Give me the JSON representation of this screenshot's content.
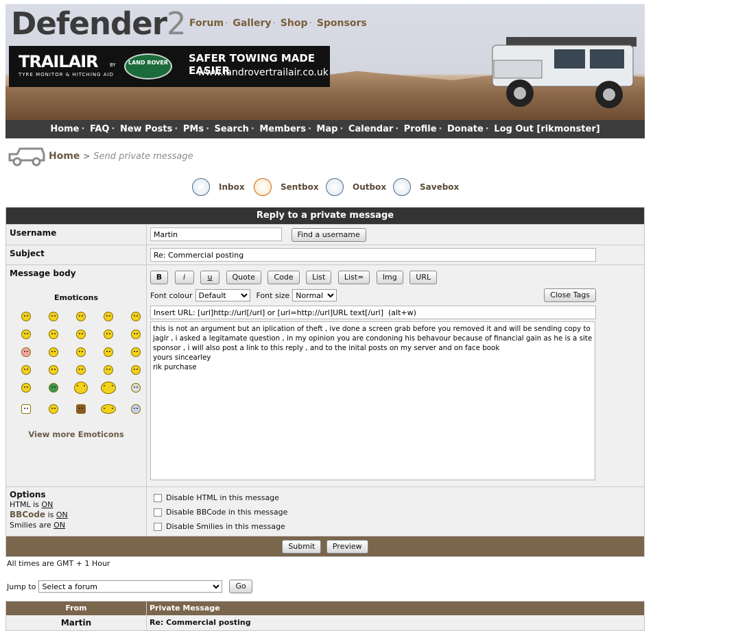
{
  "site": {
    "logo_main": "Defender",
    "logo_num": "2",
    "top_links": [
      "Forum",
      "Gallery",
      "Shop",
      "Sponsors"
    ]
  },
  "banner": {
    "brand": "TRAILAIR",
    "tagline": "TYRE MONITOR & HITCHING AID",
    "by": "BY",
    "partner": "LAND ROVER",
    "slogan": "SAFER TOWING MADE EASIER",
    "url": "www.landrovertrailair.co.uk"
  },
  "nav": [
    "Home",
    "FAQ",
    "New Posts",
    "PMs",
    "Search",
    "Members",
    "Map",
    "Calendar",
    "Profile",
    "Donate",
    "Log Out [rikmonster]"
  ],
  "breadcrumb": {
    "home": "Home",
    "sep": ">",
    "current": "Send private message"
  },
  "folders": [
    "Inbox",
    "Sentbox",
    "Outbox",
    "Savebox"
  ],
  "form": {
    "caption": "Reply to a private message",
    "username_label": "Username",
    "username_value": "Martin",
    "find_button": "Find a username",
    "subject_label": "Subject",
    "subject_value": "Re: Commercial posting",
    "body_label": "Message body",
    "emoticons_title": "Emoticons",
    "more_emoticons": "View more Emoticons",
    "bbcode_buttons": [
      "B",
      "i",
      "u",
      "Quote",
      "Code",
      "List",
      "List=",
      "Img",
      "URL"
    ],
    "font_colour_label": "Font colour",
    "font_colour_value": "Default",
    "font_size_label": "Font size",
    "font_size_value": "Normal",
    "close_tags": "Close Tags",
    "help_line": "Insert URL: [url]http://url[/url] or [url=http://url]URL text[/url]  (alt+w)",
    "message": "this is not an argument but an iplication of theft , ive done a screen grab before you removed it and will be sending copy to jaglr , i asked a legitamate question , in my opinion you are condoning his behavour because of financial gain as he is a site sponsor , i will also post a link to this reply , and to the inital posts on my server and on face book\nyours sincearley\nrik purchase",
    "options_label": "Options",
    "html_is": "HTML is",
    "bbcode_is_link": "BBCode",
    "bbcode_is": "is",
    "smilies_are": "Smilies are",
    "on": "ON",
    "options": [
      "Disable HTML in this message",
      "Disable BBCode in this message",
      "Disable Smilies in this message"
    ],
    "submit": "Submit",
    "preview": "Preview"
  },
  "footer": {
    "times": "All times are GMT + 1 Hour",
    "jump_label": "Jump to",
    "jump_value": "Select a forum",
    "go": "Go"
  },
  "history": {
    "col_from": "From",
    "col_msg": "Private Message",
    "rows": [
      {
        "from": "Martin",
        "msg": "Re: Commercial posting"
      }
    ]
  },
  "colors": {
    "accent_brown": "#7a654d",
    "nav_dark": "#3d3d3d",
    "link_brown": "#6b5a45"
  }
}
